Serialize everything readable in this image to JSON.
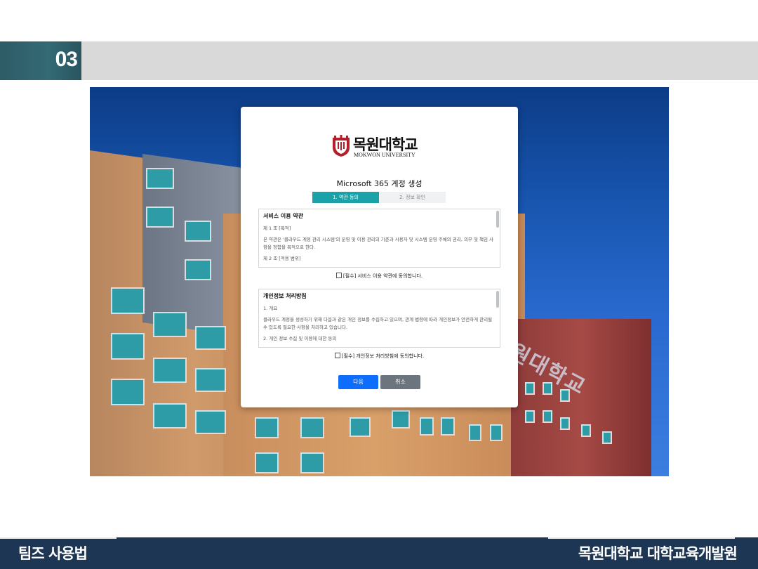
{
  "slide": {
    "section_number": "03",
    "footer_left": "팀즈 사용법",
    "footer_right": "목원대학교 대학교육개발원"
  },
  "background": {
    "building_sign": "목원대학교"
  },
  "modal": {
    "logo_korean": "목원대학교",
    "logo_english": "MOKWON UNIVERSITY",
    "title": "Microsoft 365 계정 생성",
    "steps": [
      "1. 약관 동의",
      "2. 정보 확인"
    ],
    "active_step": 1,
    "terms_service": {
      "heading": "서비스 이용 약관",
      "lines": [
        "제 1 조 [목적]",
        "본 약관은 '클라우드 계정 관리 시스템'의 운영 및 이용 관리의 기준과 사용자 및 시스템 운영 주체의 권리, 의무 및 책임 사항을 정함을 목적으로 한다.",
        "제 2 조 [적용 범위]"
      ]
    },
    "agree_service": "[필수] 서비스 이용 약관에 동의합니다.",
    "terms_privacy": {
      "heading": "개인정보 처리방침",
      "lines": [
        "1. 개요",
        "클라우드 계정을 생성하기 위해 다음과 같은 개인 정보를 수집하고 있으며, 관계 법령에 따라 개인정보가 안전하게 관리될 수 있도록 필요한 사항을 처리하고 있습니다.",
        "2. 개인 정보 수집 및 이용에 대한 동의"
      ]
    },
    "agree_privacy": "[필수] 개인정보 처리방침에 동의합니다.",
    "next_label": "다음",
    "cancel_label": "취소"
  },
  "colors": {
    "accent": "#1aa2a8",
    "primary_button": "#0d6efd",
    "secondary_button": "#6c757d",
    "footer": "#1d3654",
    "header_number_bg": "#2e5c67"
  }
}
